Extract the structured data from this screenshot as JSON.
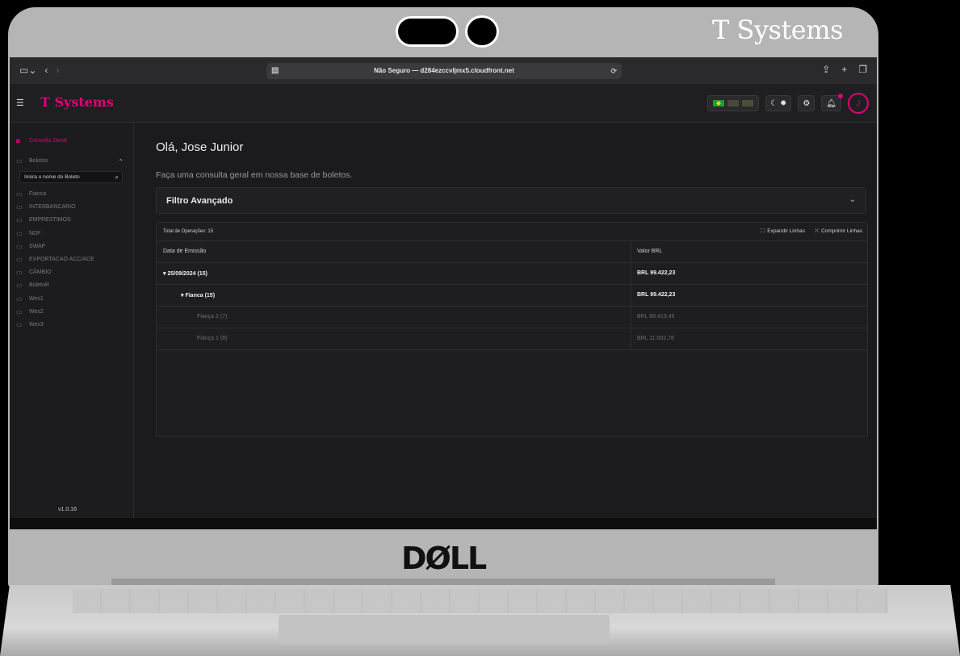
{
  "lid": {
    "brand": "T Systems",
    "dell": "DØLL"
  },
  "browser": {
    "url": "Não Seguro — d284ezccvljmx5.cloudfront.net",
    "left_icons": [
      "sidebar-icon",
      "chevron-left-icon",
      "chevron-right-icon"
    ],
    "right_icons": [
      "share-icon",
      "plus-icon",
      "tabs-icon"
    ]
  },
  "header": {
    "logo": "T Systems",
    "languages": [
      "pt-BR",
      "en-US",
      "es"
    ],
    "theme_toggle": "☾ ✹",
    "settings": "⚙",
    "notifications": "♫",
    "avatar_initial": "J",
    "colors": {
      "brand": "#e20074",
      "background": "#1b1b1d"
    }
  },
  "sidebar": {
    "consulta_geral": "Consulta Geral",
    "boletos": "Boletos",
    "search_placeholder": "Insira o nome do Boleto",
    "items": [
      "Fianca",
      "INTERBANCARIO",
      "EMPRESTIMOS",
      "NDF",
      "SWAP",
      "EXPORTACAO ACC/ACE",
      "CÂMBIO",
      "BoletoR",
      "Wes1",
      "Wes2",
      "Wes3"
    ],
    "version": "v1.0.16"
  },
  "main": {
    "greeting": "Olá, Jose Junior",
    "subtitle": "Faça uma consulta geral em nossa base de boletos.",
    "filter_label": "Filtro Avançado",
    "total_ops": "Total de Operações: 15",
    "expand": "Expandir Linhas",
    "collapse": "Comprimir Linhas",
    "columns": [
      "Data de Emissão",
      "Valor BRL"
    ],
    "rows": [
      {
        "label": "▾  25/09/2024 (15)",
        "value": "BRL 99.422,23"
      },
      {
        "label": "▾  Fianca (15)",
        "value": "BRL 99.422,23"
      },
      {
        "label": "Fiança 2 (7)",
        "value": "BRL 88.419,45"
      },
      {
        "label": "Fiança 1 (8)",
        "value": "BRL 11.002,78"
      }
    ]
  }
}
